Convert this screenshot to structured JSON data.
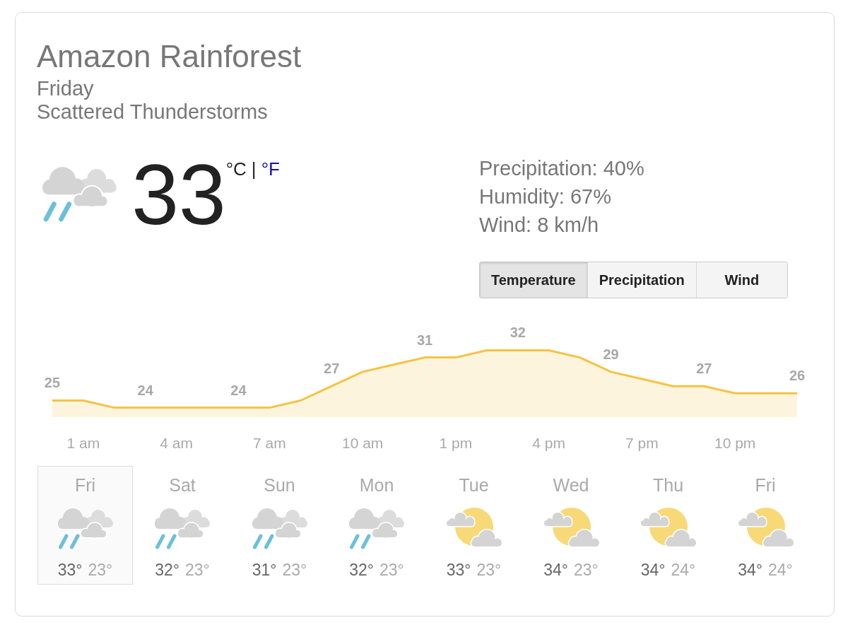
{
  "location": {
    "name": "Amazon Rainforest",
    "day": "Friday",
    "condition": "Scattered Thunderstorms"
  },
  "current": {
    "kind": "rain",
    "temperature": "33",
    "units": [
      {
        "label": "°C",
        "selected": true
      },
      {
        "label": "°F",
        "selected": false
      }
    ],
    "unit_separator": "|"
  },
  "details": [
    "Precipitation: 40%",
    "Humidity: 67%",
    "Wind: 8 km/h"
  ],
  "tabs": [
    {
      "label": "Temperature",
      "selected": true
    },
    {
      "label": "Precipitation",
      "selected": false
    },
    {
      "label": "Wind",
      "selected": false
    }
  ],
  "chart_data": {
    "type": "area",
    "categories": [
      null,
      "1 am",
      null,
      null,
      "4 am",
      null,
      null,
      "7 am",
      null,
      null,
      "10 am",
      null,
      null,
      "1 pm",
      null,
      null,
      "4 pm",
      null,
      null,
      "7 pm",
      null,
      null,
      "10 pm",
      null,
      null
    ],
    "values": [
      25,
      25,
      24,
      24,
      24,
      24,
      24,
      24,
      25,
      27,
      29,
      30,
      31,
      31,
      32,
      32,
      32,
      31,
      29,
      28,
      27,
      27,
      26,
      26,
      26
    ],
    "value_labels": [
      "25",
      null,
      null,
      "24",
      null,
      null,
      "24",
      null,
      null,
      "27",
      null,
      null,
      "31",
      null,
      null,
      "32",
      null,
      null,
      "29",
      null,
      null,
      "27",
      null,
      null,
      "26"
    ],
    "color": "#f5c342"
  },
  "forecast": [
    {
      "day": "Fri",
      "kind": "rain",
      "high": "33°",
      "low": "23°",
      "selected": true
    },
    {
      "day": "Sat",
      "kind": "rain",
      "high": "32°",
      "low": "23°",
      "selected": false
    },
    {
      "day": "Sun",
      "kind": "rain",
      "high": "31°",
      "low": "23°",
      "selected": false
    },
    {
      "day": "Mon",
      "kind": "rain",
      "high": "32°",
      "low": "23°",
      "selected": false
    },
    {
      "day": "Tue",
      "kind": "partly_cloudy",
      "high": "33°",
      "low": "23°",
      "selected": false
    },
    {
      "day": "Wed",
      "kind": "partly_cloudy",
      "high": "34°",
      "low": "23°",
      "selected": false
    },
    {
      "day": "Thu",
      "kind": "partly_cloudy",
      "high": "34°",
      "low": "24°",
      "selected": false
    },
    {
      "day": "Fri",
      "kind": "partly_cloudy",
      "high": "34°",
      "low": "24°",
      "selected": false
    }
  ]
}
